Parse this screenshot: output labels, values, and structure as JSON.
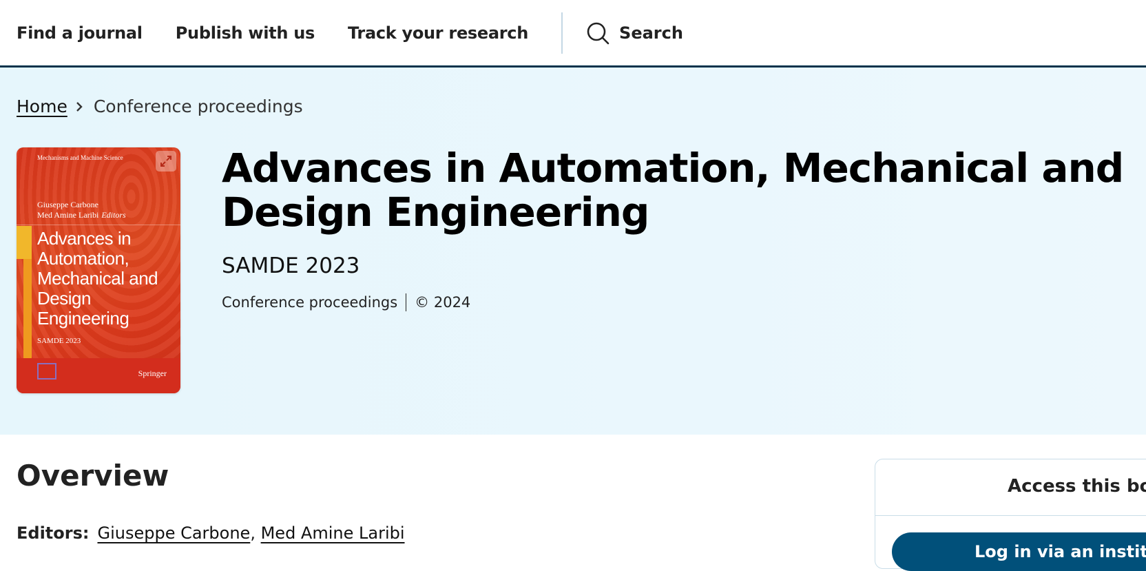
{
  "nav": {
    "links": [
      "Find a journal",
      "Publish with us",
      "Track your research"
    ],
    "search_label": "Search"
  },
  "breadcrumb": {
    "home": "Home",
    "current": "Conference proceedings"
  },
  "cover": {
    "series": "Mechanisms and Machine Science",
    "editor1": "Giuseppe Carbone",
    "editor2": "Med Amine Laribi",
    "editors_word": "Editors",
    "title": "Advances in Automation, Mechanical and Design Engineering",
    "subtitle": "SAMDE 2023",
    "publisher": "Springer"
  },
  "book": {
    "title": "Advances in Automation, Mechanical and Design Engineering",
    "subtitle": "SAMDE 2023",
    "type": "Conference proceedings",
    "copyright": "© 2024"
  },
  "overview": {
    "heading": "Overview",
    "editors_label": "Editors:",
    "editors": [
      "Giuseppe Carbone",
      "Med Amine Laribi"
    ]
  },
  "access": {
    "heading": "Access this book",
    "login_button": "Log in via an institution"
  },
  "colors": {
    "nav_border": "#01324b",
    "hero_bg": "#e8f6fc",
    "cover_red": "#dc3a1c",
    "button_blue": "#01507a"
  }
}
